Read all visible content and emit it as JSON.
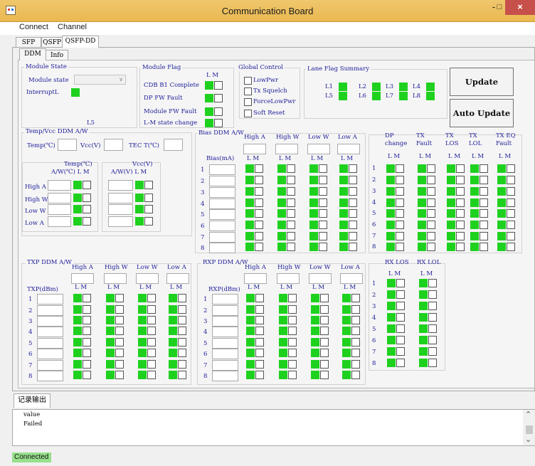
{
  "window": {
    "title": "Communication Board",
    "minimize": "-",
    "maximize": "□",
    "close": "×"
  },
  "menu": [
    "Connect",
    "Channel"
  ],
  "outer_tabs": [
    "SFP",
    "QSFP",
    "QSFP-DD"
  ],
  "inner_tabs": [
    "DDM",
    "Info"
  ],
  "module_state": {
    "title": "Module State",
    "state_label": "Module state",
    "interrupt_label": "InterruptL",
    "lane_label": "L5"
  },
  "module_flag": {
    "title": "Module Flag",
    "lm": "L  M",
    "rows": [
      "CDB B1 Complete",
      "DP FW Fault",
      "Module FW Fault",
      "L-M state change"
    ]
  },
  "global_control": {
    "title": "Global Control",
    "items": [
      "LowPwr",
      "Tx Squelch",
      "ForceLowPwr",
      "Soft Reset"
    ]
  },
  "lane_flag": {
    "title": "Lane Flag Summary",
    "lanes": [
      "L1",
      "L2",
      "L3",
      "L4",
      "L5",
      "L6",
      "L7",
      "L8"
    ]
  },
  "buttons": {
    "update": "Update",
    "auto_update": "Auto Update"
  },
  "temp_vcc": {
    "title": "Temp/Vcc DDM A/W",
    "temp": "Temp(℃)",
    "vcc": "Vcc(V)",
    "tec": "TEC T(℃)",
    "temp_hdr1": "Temp(℃)",
    "temp_hdr2": "A/W(℃) L M",
    "vcc_hdr1": "Vcc(V)",
    "vcc_hdr2": "A/W(V)  L M"
  },
  "thr_rows": [
    "High A",
    "High W",
    "Low W",
    "Low A"
  ],
  "thr_cols": [
    "High A",
    "High W",
    "Low W",
    "Low A"
  ],
  "lm": "L M",
  "lanes": [
    "1",
    "2",
    "3",
    "4",
    "5",
    "6",
    "7",
    "8"
  ],
  "bias": {
    "title": "Bias DDM A/W",
    "unit": "Bias(mA)"
  },
  "txp": {
    "title": "TXP DDM A/W",
    "unit": "TXP(dBm)"
  },
  "rxp": {
    "title": "RXP DDM A/W",
    "unit": "RXP(dBm)"
  },
  "tx_flags": [
    {
      "line1": "DP",
      "line2": "change"
    },
    {
      "line1": "TX",
      "line2": "Fault"
    },
    {
      "line1": "TX",
      "line2": "LOS"
    },
    {
      "line1": "TX",
      "line2": "LOL"
    },
    {
      "line1": "TX EQ",
      "line2": "Fault"
    }
  ],
  "rx_flags": [
    "RX LOS",
    "RX LOL"
  ],
  "log": {
    "tab": "记录输出",
    "lines": [
      "value",
      "Failed"
    ],
    "up": "⌃",
    "down": "⌄"
  },
  "status": {
    "text": "Connected"
  },
  "colors": {
    "indicator_on": "#1fd11f",
    "status_bg": "#98e08c",
    "titlebar": "#eebf5f",
    "close": "#c7504a"
  }
}
